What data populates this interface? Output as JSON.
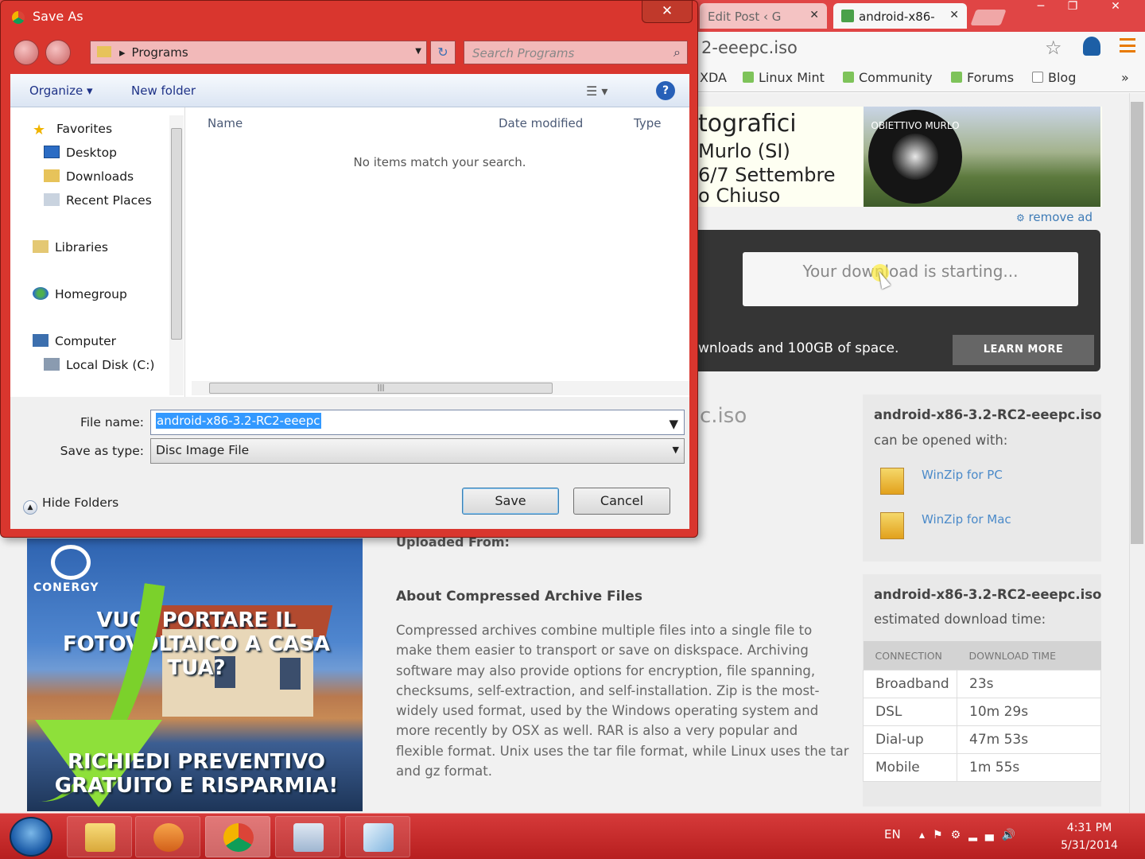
{
  "browser": {
    "tabs": [
      {
        "label": "Edit Post ‹ G"
      },
      {
        "label": "android-x86-"
      }
    ],
    "window_controls": [
      "─",
      "❐",
      "✕"
    ],
    "url_fragment": "2-eeepc.iso",
    "bookmarks": [
      "XDA",
      "Linux Mint",
      "Community",
      "Forums",
      "Blog"
    ],
    "bookmarks_more": "»"
  },
  "top_ad": {
    "lines": [
      "tografici",
      "Murlo (SI)",
      "6/7 Settembre",
      "o Chiuso"
    ],
    "badge_text": "OBIETTIVO MURLO",
    "remove_ad": "remove ad"
  },
  "download_box": {
    "status": "Your download is starting...",
    "promo_text": "wnloads and 100GB of space.",
    "learn_more": "LEARN MORE",
    "filename_fragment": "c.iso"
  },
  "side1": {
    "title": "android-x86-3.2-RC2-eeepc.iso",
    "subtitle": "can be opened with:",
    "links": [
      "WinZip for PC",
      "WinZip for Mac"
    ]
  },
  "side2": {
    "title": "android-x86-3.2-RC2-eeepc.iso",
    "subtitle": "estimated download time:",
    "headers": [
      "CONNECTION",
      "DOWNLOAD TIME"
    ],
    "rows": [
      [
        "Broadband",
        "23s"
      ],
      [
        "DSL",
        "10m 29s"
      ],
      [
        "Dial-up",
        "47m 53s"
      ],
      [
        "Mobile",
        "1m 55s"
      ]
    ]
  },
  "content": {
    "uploaded_from": "Uploaded From:",
    "about_heading": "About Compressed Archive Files",
    "about_body": "Compressed archives combine multiple files into a single file to make them easier to transport or save on diskspace. Archiving software may also provide options for encryption, file spanning, checksums, self-extraction, and self-installation. Zip is the most-widely used format, used by the Windows operating system and more recently by OSX as well. RAR is also a very popular and flexible format. Unix uses the tar file format, while Linux uses the tar and gz format."
  },
  "left_ad": {
    "logo_text": "CONERGY",
    "headline1": "VUOI PORTARE IL",
    "headline2": "FOTOVOLTAICO A CASA TUA?",
    "headline3": "RICHIEDI PREVENTIVO",
    "headline4": "GRATUITO E RISPARMIA!"
  },
  "dialog": {
    "title": "Save As",
    "close": "✕",
    "breadcrumb": "Programs",
    "search_placeholder": "Search Programs",
    "organize": "Organize ▾",
    "new_folder": "New folder",
    "help": "?",
    "nav": {
      "favorites": "Favorites",
      "desktop": "Desktop",
      "downloads": "Downloads",
      "recent": "Recent Places",
      "libraries": "Libraries",
      "homegroup": "Homegroup",
      "computer": "Computer",
      "local_disk": "Local Disk (C:)"
    },
    "columns": {
      "name": "Name",
      "date": "Date modified",
      "type": "Type"
    },
    "empty_message": "No items match your search.",
    "file_name_label": "File name:",
    "file_name_value": "android-x86-3.2-RC2-eeepc",
    "save_type_label": "Save as type:",
    "save_type_value": "Disc Image File",
    "hide_folders": "Hide Folders",
    "save_button": "Save",
    "cancel_button": "Cancel"
  },
  "taskbar": {
    "language": "EN",
    "time": "4:31 PM",
    "date": "5/31/2014"
  },
  "colors": {
    "accent": "#d9362e",
    "link": "#4b8ac9",
    "download_box": "#353535"
  }
}
